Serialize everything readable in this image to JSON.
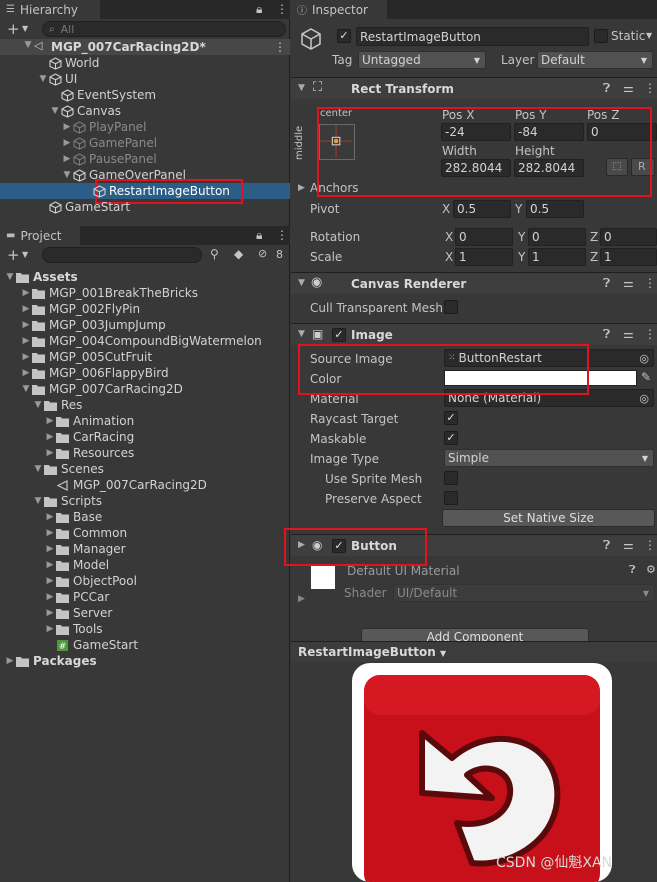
{
  "hierarchy": {
    "tab_label": "Hierarchy",
    "search_placeholder": "All",
    "scene_name": "MGP_007CarRacing2D*",
    "items": [
      {
        "label": "World",
        "depth": 1,
        "dim": false
      },
      {
        "label": "UI",
        "depth": 1,
        "dim": false
      },
      {
        "label": "EventSystem",
        "depth": 2,
        "dim": false
      },
      {
        "label": "Canvas",
        "depth": 2,
        "dim": false
      },
      {
        "label": "PlayPanel",
        "depth": 3,
        "dim": true
      },
      {
        "label": "GamePanel",
        "depth": 3,
        "dim": true
      },
      {
        "label": "PausePanel",
        "depth": 3,
        "dim": true
      },
      {
        "label": "GameOverPanel",
        "depth": 3,
        "dim": false
      },
      {
        "label": "RestartImageButton",
        "depth": 4,
        "dim": false
      },
      {
        "label": "GameStart",
        "depth": 1,
        "dim": false
      }
    ]
  },
  "project": {
    "tab_label": "Project",
    "hidden_count": "8",
    "root_label": "Assets",
    "items": [
      {
        "label": "MGP_001BreakTheBricks"
      },
      {
        "label": "MGP_002FlyPin"
      },
      {
        "label": "MGP_003JumpJump"
      },
      {
        "label": "MGP_004CompoundBigWatermelon"
      },
      {
        "label": "MGP_005CutFruit"
      },
      {
        "label": "MGP_006FlappyBird"
      },
      {
        "label": "MGP_007CarRacing2D"
      },
      {
        "label": "Res"
      },
      {
        "label": "Animation"
      },
      {
        "label": "CarRacing"
      },
      {
        "label": "Resources"
      },
      {
        "label": "Scenes"
      },
      {
        "label": "MGP_007CarRacing2D"
      },
      {
        "label": "Scripts"
      },
      {
        "label": "Base"
      },
      {
        "label": "Common"
      },
      {
        "label": "Manager"
      },
      {
        "label": "Model"
      },
      {
        "label": "ObjectPool"
      },
      {
        "label": "PCCar"
      },
      {
        "label": "Server"
      },
      {
        "label": "Tools"
      },
      {
        "label": "GameStart"
      },
      {
        "label": "Packages"
      }
    ]
  },
  "inspector": {
    "tab_label": "Inspector",
    "object_name": "RestartImageButton",
    "static_label": "Static",
    "tag_label": "Tag",
    "tag_value": "Untagged",
    "layer_label": "Layer",
    "layer_value": "Default",
    "rect_transform": {
      "title": "Rect Transform",
      "anchor_h": "center",
      "anchor_v": "middle",
      "posx_label": "Pos X",
      "posy_label": "Pos Y",
      "posz_label": "Pos Z",
      "posx": "-24",
      "posy": "-84",
      "posz": "0",
      "width_label": "Width",
      "height_label": "Height",
      "width": "282.8044",
      "height": "282.8044",
      "r_button": "R",
      "anchors_label": "Anchors",
      "pivot_label": "Pivot",
      "pivot_x": "0.5",
      "pivot_y": "0.5",
      "rotation_label": "Rotation",
      "rot_x": "0",
      "rot_y": "0",
      "rot_z": "0",
      "scale_label": "Scale",
      "scale_x": "1",
      "scale_y": "1",
      "scale_z": "1",
      "x": "X",
      "y": "Y",
      "z": "Z"
    },
    "canvas_renderer": {
      "title": "Canvas Renderer",
      "cull_label": "Cull Transparent Mesh"
    },
    "image": {
      "title": "Image",
      "source_label": "Source Image",
      "source_value": "ButtonRestart",
      "color_label": "Color",
      "material_label": "Material",
      "material_value": "None (Material)",
      "raycast_label": "Raycast Target",
      "maskable_label": "Maskable",
      "type_label": "Image Type",
      "type_value": "Simple",
      "sprite_mesh_label": "Use Sprite Mesh",
      "preserve_label": "Preserve Aspect",
      "native_button": "Set Native Size"
    },
    "button": {
      "title": "Button"
    },
    "material": {
      "name": "Default UI Material",
      "shader_label": "Shader",
      "shader_value": "UI/Default"
    },
    "add_component": "Add Component",
    "preview_label": "RestartImageButton"
  },
  "watermark": "CSDN @仙魁XAN",
  "colors": {
    "selection": "#2c5d87",
    "highlight_box": "#e0141e",
    "button_red": "#c8101a"
  }
}
